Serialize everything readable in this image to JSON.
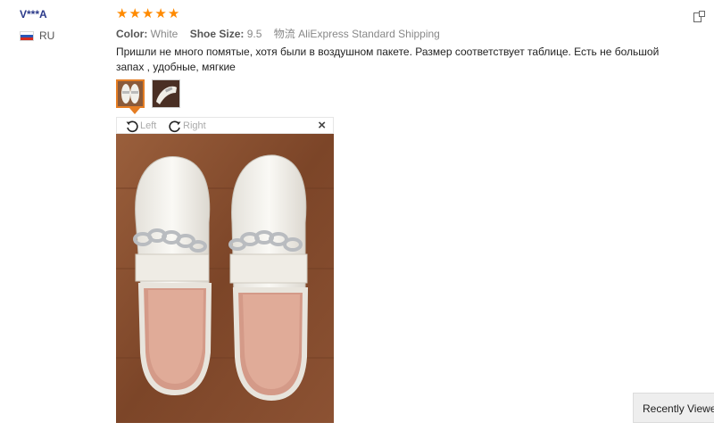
{
  "reviewer": {
    "name": "V***A",
    "country": "RU"
  },
  "rating": {
    "stars": 5
  },
  "meta": {
    "color_label": "Color:",
    "color_value": "White",
    "size_label": "Shoe Size:",
    "size_value": "9.5",
    "shipping": "物流 AliExpress Standard Shipping"
  },
  "review_text": "Пришли не много помятые, хотя были в воздушном пакете. Размер соответствует таблице. Есть не большой запах , удобные, мягкие",
  "viewer": {
    "rotate_left": "Left",
    "rotate_right": "Right",
    "close": "×"
  },
  "recently_viewed": "Recently Viewed",
  "icons": {
    "star": "star-icon",
    "flag": "russia-flag-icon",
    "rotate_left": "rotate-left-icon",
    "rotate_right": "rotate-right-icon",
    "close": "close-icon"
  },
  "colors": {
    "accent": "#e57d23",
    "stars": "#ff8a00",
    "name": "#2b3a8a"
  }
}
